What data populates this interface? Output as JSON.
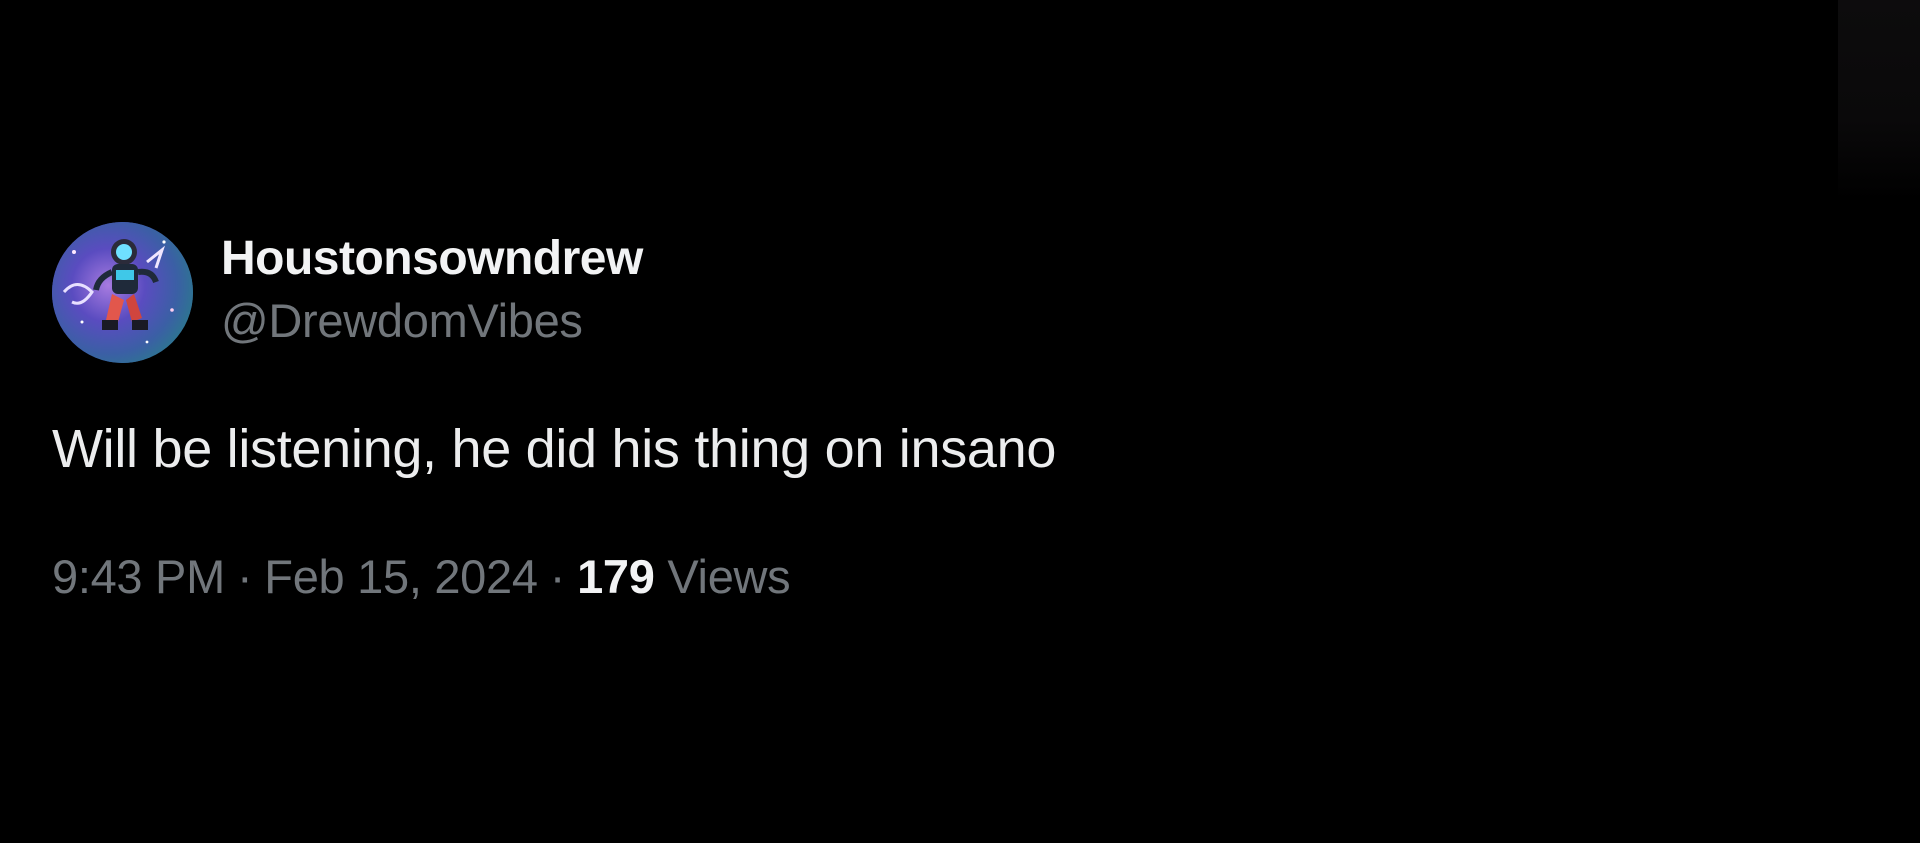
{
  "tweet": {
    "author": {
      "display_name": "Houstonsowndrew",
      "handle": "@DrewdomVibes",
      "avatar_icon": "astronaut-avatar"
    },
    "text": "Will be listening, he did his thing on insano",
    "meta": {
      "time": "9:43 PM",
      "separator": "·",
      "date": "Feb 15, 2024",
      "views_count": "179",
      "views_label": "Views"
    }
  },
  "colors": {
    "background": "#000000",
    "primary_text": "#e7e9ea",
    "secondary_text": "#71767b"
  }
}
